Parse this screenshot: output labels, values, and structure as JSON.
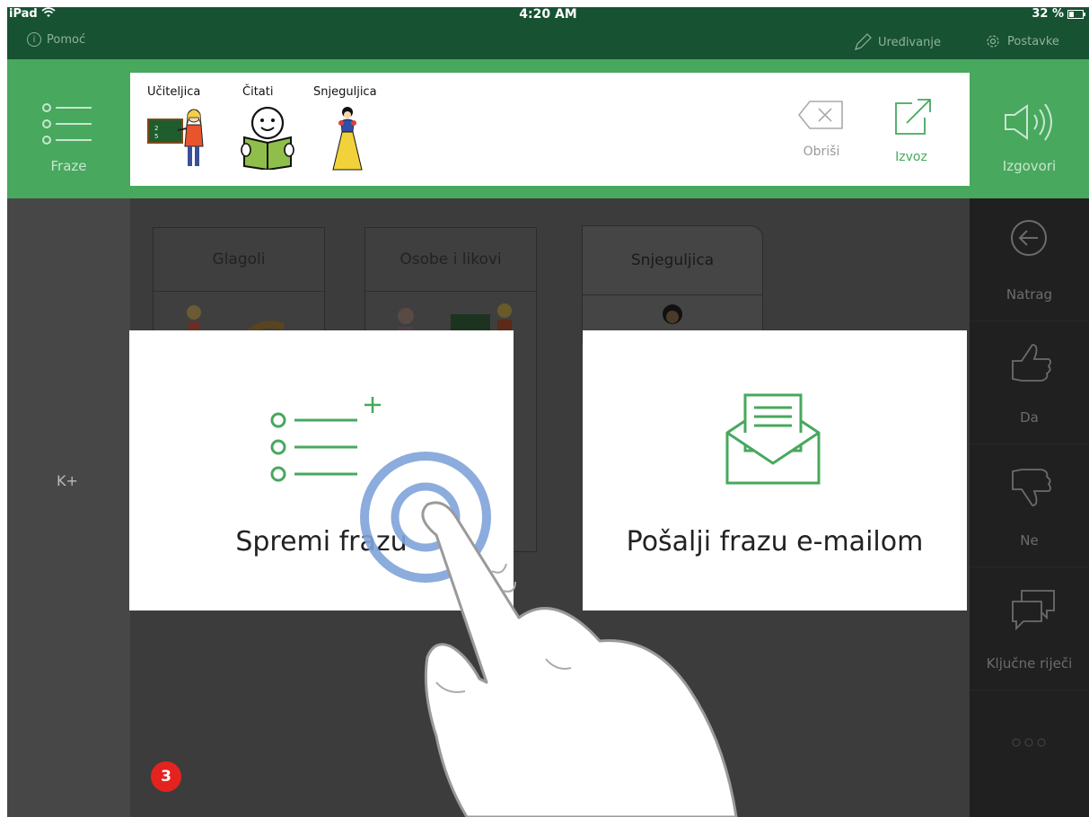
{
  "status_bar": {
    "device": "iPad",
    "time": "4:20 AM",
    "battery": "32 %",
    "help": "Pomoć",
    "edit": "Uređivanje",
    "settings": "Postavke"
  },
  "toolbar": {
    "phrases_label": "Fraze",
    "speak_label": "Izgovori",
    "delete_label": "Obriši",
    "export_label": "Izvoz"
  },
  "phrase": {
    "words": [
      {
        "label": "Učiteljica"
      },
      {
        "label": "Čitati"
      },
      {
        "label": "Snjeguljica"
      }
    ]
  },
  "left_column": {
    "label": "K+"
  },
  "folders": [
    {
      "title": "Glagoli"
    },
    {
      "title": "Osobe i likovi"
    },
    {
      "title": "Snjeguljica"
    }
  ],
  "right_column": {
    "items": [
      {
        "label": "Natrag",
        "icon": "back-arrow-icon"
      },
      {
        "label": "Da",
        "icon": "thumbs-up-icon"
      },
      {
        "label": "Ne",
        "icon": "thumbs-down-icon"
      },
      {
        "label": "Ključne riječi",
        "icon": "speech-bubbles-icon"
      }
    ]
  },
  "dialog": {
    "save_label": "Spremi frazu",
    "email_label": "Pošalji frazu e-mailom"
  },
  "step_badge": "3",
  "colors": {
    "accent": "#47a85e",
    "status_bar": "#175233",
    "badge": "#e4231f",
    "tap_ring": "#7ea3d9"
  }
}
